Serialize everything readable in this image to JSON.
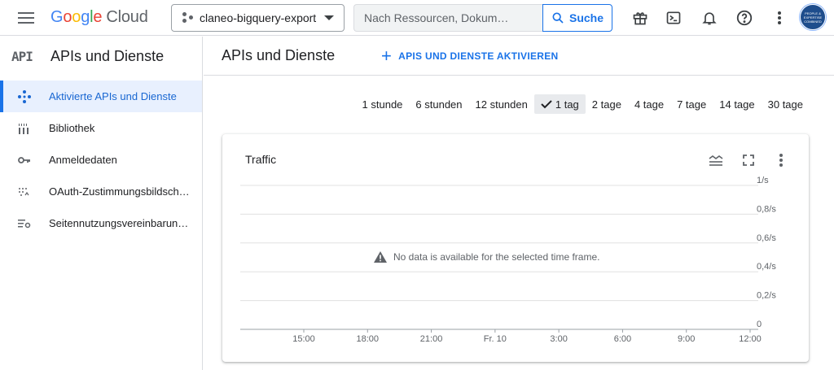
{
  "app": {
    "logo": {
      "g1": "G",
      "g2": "o",
      "g3": "o",
      "g4": "g",
      "g5": "l",
      "g6": "e",
      "cloud": "Cloud"
    },
    "project_name": "claneo-bigquery-export",
    "search_placeholder": "Nach Ressourcen, Dokum…",
    "search_button": "Suche",
    "avatar_text": "PEOPLE & EXPERTISE COMBINED",
    "toolbar_icons": [
      "gift-icon",
      "cloud-shell-icon",
      "bell-icon",
      "help-icon",
      "more-vert-icon"
    ]
  },
  "sidebar": {
    "header_icon": "API",
    "header_title": "APIs und Dienste",
    "items": [
      {
        "label": "Aktivierte APIs und Dienste",
        "icon": "api-diamond-icon",
        "active": true
      },
      {
        "label": "Bibliothek",
        "icon": "library-icon",
        "active": false
      },
      {
        "label": "Anmeldedaten",
        "icon": "key-icon",
        "active": false
      },
      {
        "label": "OAuth-Zustimmungsbildschi…",
        "icon": "oauth-icon",
        "active": false
      },
      {
        "label": "Seitennutzungsvereinbarung…",
        "icon": "settings-list-icon",
        "active": false
      }
    ]
  },
  "main": {
    "title": "APIs und Dienste",
    "enable_button": "APIS UND DIENSTE AKTIVIEREN",
    "time_ranges": [
      {
        "label": "1 stunde",
        "selected": false
      },
      {
        "label": "6 stunden",
        "selected": false
      },
      {
        "label": "12 stunden",
        "selected": false
      },
      {
        "label": "1 tag",
        "selected": true
      },
      {
        "label": "2 tage",
        "selected": false
      },
      {
        "label": "4 tage",
        "selected": false
      },
      {
        "label": "7 tage",
        "selected": false
      },
      {
        "label": "14 tage",
        "selected": false
      },
      {
        "label": "30 tage",
        "selected": false
      }
    ],
    "card": {
      "title": "Traffic",
      "no_data": "No data is available for the selected time frame."
    }
  },
  "chart_data": {
    "type": "line",
    "title": "Traffic",
    "x_ticks": [
      "15:00",
      "18:00",
      "21:00",
      "Fr. 10",
      "3:00",
      "6:00",
      "9:00",
      "12:00"
    ],
    "y_ticks": [
      "0",
      "0,2/s",
      "0,4/s",
      "0,6/s",
      "0,8/s",
      "1/s"
    ],
    "ylim": [
      0,
      1
    ],
    "series": [],
    "grid": true
  }
}
